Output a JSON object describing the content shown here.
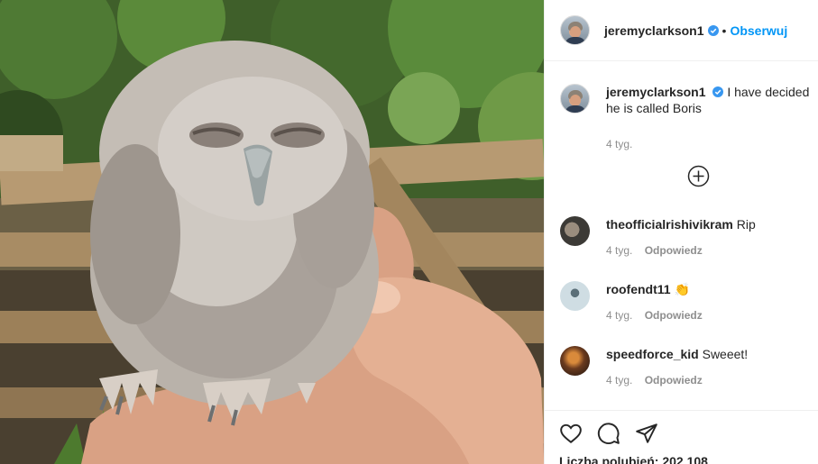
{
  "header": {
    "username": "jeremyclarkson1",
    "separator": "•",
    "follow_label": "Obserwuj"
  },
  "caption": {
    "username": "jeremyclarkson1",
    "text": "I have decided he is called Boris",
    "time": "4 tyg."
  },
  "comments": [
    {
      "username": "theofficialrishivikram",
      "text": "Rip",
      "time": "4 tyg.",
      "reply": "Odpowiedz"
    },
    {
      "username": "roofendt11",
      "text": "👏",
      "time": "4 tyg.",
      "reply": "Odpowiedz"
    },
    {
      "username": "speedforce_kid",
      "text": "Sweeet!",
      "time": "4 tyg.",
      "reply": "Odpowiedz"
    }
  ],
  "actions": {
    "like_icon": "heart-icon",
    "comment_icon": "comment-icon",
    "share_icon": "share-icon"
  },
  "likes_text": "Liczba polubień: 202 108",
  "colors": {
    "link": "#0095f6",
    "verified": "#3897f0",
    "muted": "#8e8e8e"
  }
}
